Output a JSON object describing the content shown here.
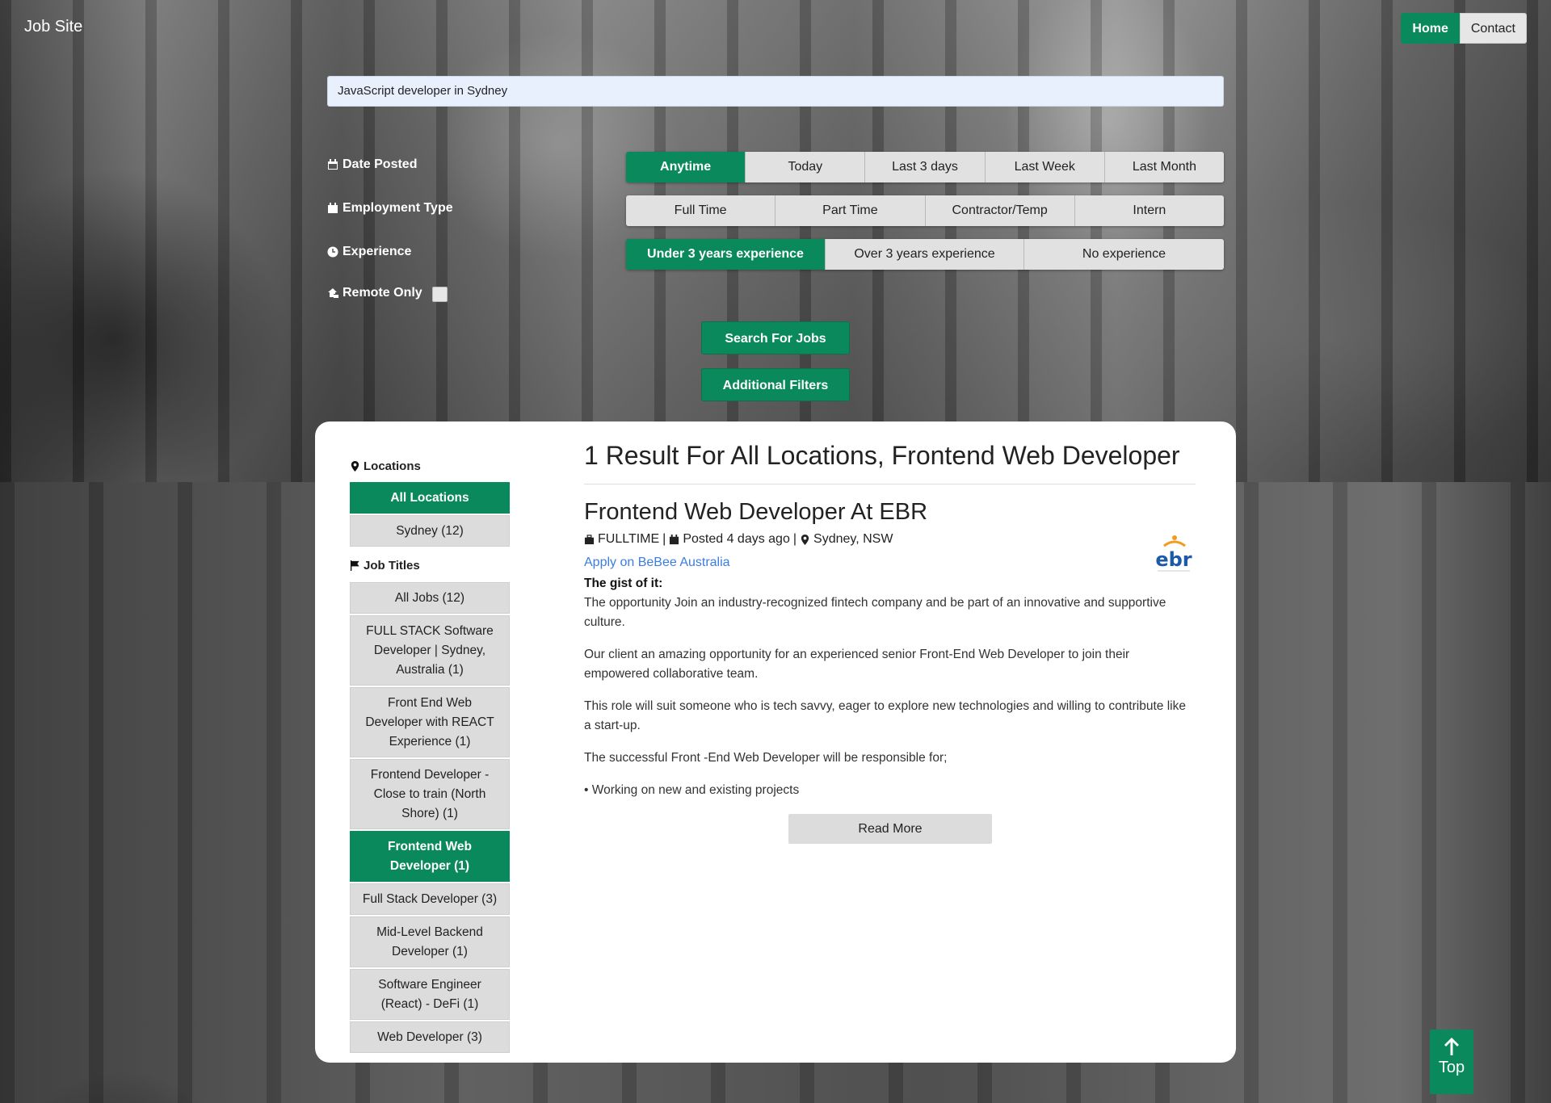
{
  "brand": "Job Site",
  "nav": {
    "home": "Home",
    "contact": "Contact"
  },
  "search": {
    "value": "JavaScript developer in Sydney"
  },
  "filters": {
    "date_posted": {
      "label": "Date Posted",
      "options": [
        "Anytime",
        "Today",
        "Last 3 days",
        "Last Week",
        "Last Month"
      ],
      "selected": "Anytime"
    },
    "employment_type": {
      "label": "Employment Type",
      "options": [
        "Full Time",
        "Part Time",
        "Contractor/Temp",
        "Intern"
      ],
      "selected": ""
    },
    "experience": {
      "label": "Experience",
      "options": [
        "Under 3 years experience",
        "Over 3 years experience",
        "No experience"
      ],
      "selected": "Under 3 years experience"
    },
    "remote": {
      "label": "Remote Only",
      "checked": false
    }
  },
  "actions": {
    "search": "Search For Jobs",
    "additional": "Additional Filters"
  },
  "sidebar": {
    "locations_heading": "Locations",
    "locations": [
      {
        "label": "All Locations",
        "active": true
      },
      {
        "label": "Sydney (12)",
        "active": false
      }
    ],
    "titles_heading": "Job Titles",
    "titles": [
      {
        "label": "All Jobs (12)",
        "active": false
      },
      {
        "label": "FULL STACK Software Developer | Sydney, Australia (1)",
        "active": false
      },
      {
        "label": "Front End Web Developer with REACT Experience (1)",
        "active": false
      },
      {
        "label": "Frontend Developer - Close to train (North Shore) (1)",
        "active": false
      },
      {
        "label": "Frontend Web Developer (1)",
        "active": true
      },
      {
        "label": "Full Stack Developer (3)",
        "active": false
      },
      {
        "label": "Mid-Level Backend Developer (1)",
        "active": false
      },
      {
        "label": "Software Engineer (React) - DeFi (1)",
        "active": false
      },
      {
        "label": "Web Developer (3)",
        "active": false
      }
    ]
  },
  "results": {
    "heading": "1 Result For All Locations, Frontend Web Developer",
    "job": {
      "title": "Frontend Web Developer At EBR",
      "type": "FULLTIME",
      "posted": "Posted 4 days ago",
      "location": "Sydney, NSW",
      "sep": "|",
      "apply": "Apply on BeBee Australia",
      "logo_text": "ebr",
      "gist_label": "The gist of it:",
      "paragraphs": [
        "The opportunity Join an industry-recognized fintech company and be part of an innovative and supportive culture.",
        "Our client an amazing opportunity for an experienced senior Front-End Web Developer to join their empowered collaborative team.",
        "This role will suit someone who is tech savvy, eager to explore new technologies and willing to contribute like a start-up.",
        "The successful Front -End Web Developer will be responsible for;",
        "• Working on new and existing projects"
      ],
      "read_more": "Read More"
    }
  },
  "top_button": "Top",
  "colors": {
    "accent": "#0a8a5c",
    "link": "#3b7de0",
    "logo_blue": "#1c5aa8",
    "logo_orange": "#f39a1e"
  }
}
